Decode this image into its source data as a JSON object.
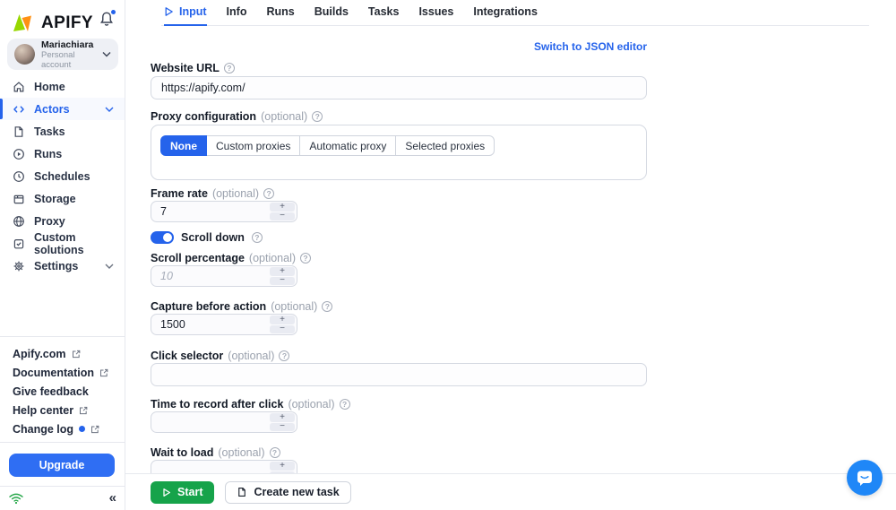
{
  "colors": {
    "accent_blue": "#2563eb",
    "upgrade_blue": "#2f6ef3",
    "start_green": "#16a34a",
    "chat_blue": "#1f87f7",
    "notification_dot_blue": "#2563eb"
  },
  "sidebar": {
    "logo_text": "APIFY",
    "bell_icon": "bell-icon",
    "user": {
      "name": "Mariachiara",
      "type": "Personal account"
    },
    "nav": [
      {
        "label": "Home",
        "icon": "home-icon"
      },
      {
        "label": "Actors",
        "icon": "code-icon",
        "active": true
      },
      {
        "label": "Tasks",
        "icon": "document-icon"
      },
      {
        "label": "Runs",
        "icon": "play-circle-icon"
      },
      {
        "label": "Schedules",
        "icon": "clock-icon"
      },
      {
        "label": "Storage",
        "icon": "storage-box-icon"
      },
      {
        "label": "Proxy",
        "icon": "globe-icon"
      },
      {
        "label": "Custom solutions",
        "icon": "box-check-icon"
      },
      {
        "label": "Settings",
        "icon": "gear-icon"
      }
    ],
    "links": [
      {
        "label": "Apify.com",
        "external": true
      },
      {
        "label": "Documentation",
        "external": true
      },
      {
        "label": "Give feedback",
        "external": false
      },
      {
        "label": "Help center",
        "external": true
      },
      {
        "label": "Change log",
        "external": true,
        "has_notification_dot": true
      }
    ],
    "upgrade_label": "Upgrade"
  },
  "header": {
    "tabs": [
      {
        "label": "Input",
        "active": true,
        "icon": "play-icon"
      },
      {
        "label": "Info"
      },
      {
        "label": "Runs"
      },
      {
        "label": "Builds"
      },
      {
        "label": "Tasks"
      },
      {
        "label": "Issues"
      },
      {
        "label": "Integrations"
      }
    ],
    "json_editor_link": "Switch to JSON editor"
  },
  "form": {
    "stepper": {
      "increment": "+",
      "decrement": "−"
    },
    "website_url": {
      "label": "Website URL",
      "value": "https://apify.com/"
    },
    "proxy": {
      "label": "Proxy configuration",
      "optional": "(optional)",
      "options": [
        "None",
        "Custom proxies",
        "Automatic proxy",
        "Selected proxies"
      ],
      "selected": "None"
    },
    "frame_rate": {
      "label": "Frame rate",
      "optional": "(optional)",
      "value": "7"
    },
    "scroll_down": {
      "label": "Scroll down",
      "enabled": true
    },
    "scroll_percentage": {
      "label": "Scroll percentage",
      "optional": "(optional)",
      "placeholder": "10",
      "value": ""
    },
    "capture_before_action": {
      "label": "Capture before action",
      "optional": "(optional)",
      "value": "1500"
    },
    "click_selector": {
      "label": "Click selector",
      "optional": "(optional)",
      "value": ""
    },
    "time_to_record_after_click": {
      "label": "Time to record after click",
      "optional": "(optional)",
      "value": ""
    },
    "wait_to_load": {
      "label": "Wait to load",
      "optional": "(optional)",
      "value": ""
    }
  },
  "run_bar": {
    "start_label": "Start",
    "create_task_label": "Create new task"
  }
}
